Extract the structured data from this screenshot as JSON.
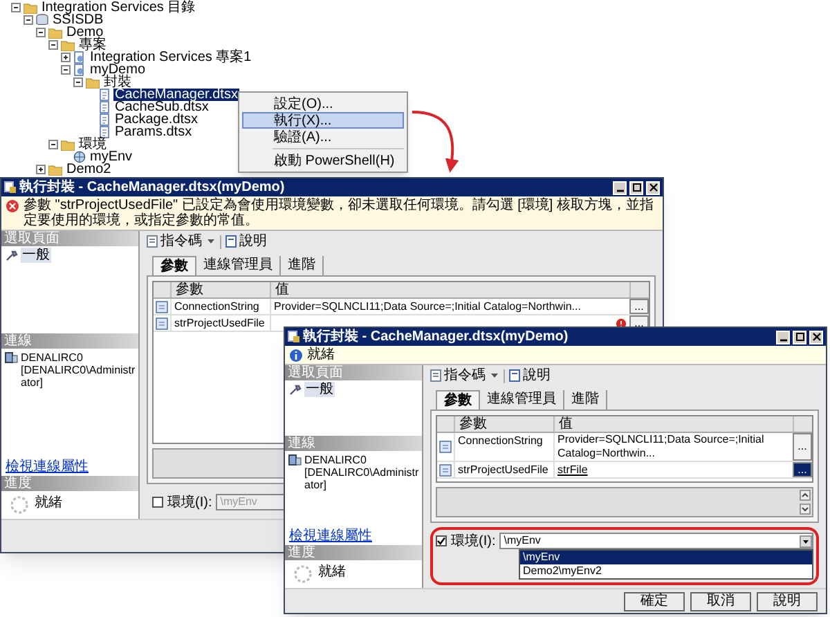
{
  "tree": [
    {
      "label": "Integration Services 目錄",
      "kind": "folder",
      "expanded": true,
      "selected": false,
      "children": [
        {
          "label": "SSISDB",
          "kind": "database",
          "expanded": true,
          "selected": false,
          "children": [
            {
              "label": "Demo",
              "kind": "folder",
              "expanded": true,
              "selected": false,
              "children": [
                {
                  "label": "專案",
                  "kind": "folder",
                  "expanded": true,
                  "selected": false,
                  "children": [
                    {
                      "label": "Integration Services 專案1",
                      "kind": "project",
                      "expanded": false,
                      "selected": false
                    },
                    {
                      "label": "myDemo",
                      "kind": "project",
                      "expanded": true,
                      "selected": false,
                      "children": [
                        {
                          "label": "封裝",
                          "kind": "folder",
                          "expanded": true,
                          "selected": false,
                          "children": [
                            {
                              "label": "CacheManager.dtsx",
                              "kind": "package",
                              "selected": true
                            },
                            {
                              "label": "CacheSub.dtsx",
                              "kind": "package",
                              "selected": false
                            },
                            {
                              "label": "Package.dtsx",
                              "kind": "package",
                              "selected": false
                            },
                            {
                              "label": "Params.dtsx",
                              "kind": "package",
                              "selected": false
                            }
                          ]
                        }
                      ]
                    }
                  ]
                },
                {
                  "label": "環境",
                  "kind": "folder",
                  "expanded": true,
                  "selected": false,
                  "children": [
                    {
                      "label": "myEnv",
                      "kind": "environment",
                      "selected": false
                    }
                  ]
                }
              ]
            },
            {
              "label": "Demo2",
              "kind": "folder",
              "expanded": false,
              "selected": false
            }
          ]
        }
      ]
    }
  ],
  "context_menu": [
    {
      "kind": "item",
      "label": "設定(O)...",
      "selected": false
    },
    {
      "kind": "item",
      "label": "執行(X)...",
      "selected": true
    },
    {
      "kind": "item",
      "label": "驗證(A)...",
      "selected": false
    },
    {
      "kind": "separator"
    },
    {
      "kind": "item",
      "label": "啟動 PowerShell(H)",
      "selected": false
    }
  ],
  "windows": [
    {
      "title": "執行封裝 - CacheManager.dtsx(myDemo)",
      "message": {
        "kind": "error",
        "text": "參數 \"strProjectUsedFile\" 已設定為會使用環境變數，卻未選取任何環境。請勾選 [環境] 核取方塊，並指定要使用的環境，或指定參數的常值。"
      },
      "pages_header": "選取頁面",
      "pages": [
        {
          "label": "一般",
          "selected": true
        }
      ],
      "connection": {
        "header": "連線",
        "server": "DENALIRC0",
        "user": "[DENALIRC0\\Administrator]",
        "link": "檢視連線屬性"
      },
      "progress": {
        "header": "進度",
        "status": "就緒"
      },
      "toolbar": {
        "script": "指令碼",
        "help": "說明"
      },
      "tabs": [
        {
          "label": "參數",
          "selected": true
        },
        {
          "label": "連線管理員",
          "selected": false
        },
        {
          "label": "進階",
          "selected": false
        }
      ],
      "grid": {
        "columns": [
          "參數",
          "值"
        ],
        "rows": [
          {
            "name": "ConnectionString",
            "value": "Provider=SQLNCLI11;Data Source=;Initial Catalog=Northwin...",
            "error": false,
            "selected": false,
            "button": "..."
          },
          {
            "name": "strProjectUsedFile",
            "error": true,
            "selected": false,
            "button": "..."
          }
        ]
      },
      "environment": {
        "checked": false,
        "label": "環境(I):",
        "value": "\\myEnv",
        "highlighted": false
      }
    },
    {
      "title": "執行封裝 - CacheManager.dtsx(myDemo)",
      "message": {
        "kind": "info",
        "text": "就緒"
      },
      "pages_header": "選取頁面",
      "pages": [
        {
          "label": "一般",
          "selected": true
        }
      ],
      "connection": {
        "header": "連線",
        "server": "DENALIRC0",
        "user": "[DENALIRC0\\Administrator]",
        "link": "檢視連線屬性"
      },
      "progress": {
        "header": "進度",
        "status": "就緒"
      },
      "toolbar": {
        "script": "指令碼",
        "help": "說明"
      },
      "tabs": [
        {
          "label": "參數",
          "selected": true
        },
        {
          "label": "連線管理員",
          "selected": false
        },
        {
          "label": "進階",
          "selected": false
        }
      ],
      "grid": {
        "columns": [
          "參數",
          "值"
        ],
        "rows": [
          {
            "name": "ConnectionString",
            "value": "Provider=SQLNCLI11;Data Source=;Initial Catalog=Northwin...",
            "error": false,
            "selected": false,
            "button": "..."
          },
          {
            "name": "strProjectUsedFile",
            "value": "strFile",
            "error": false,
            "selected": true,
            "button": "..."
          }
        ]
      },
      "environment": {
        "checked": true,
        "label": "環境(I):",
        "value": "\\myEnv",
        "highlighted": true,
        "options": [
          {
            "label": "\\myEnv",
            "selected": true
          },
          {
            "label": "Demo2\\myEnv2",
            "selected": false
          }
        ]
      },
      "buttons": [
        "確定",
        "取消",
        "說明"
      ]
    }
  ]
}
